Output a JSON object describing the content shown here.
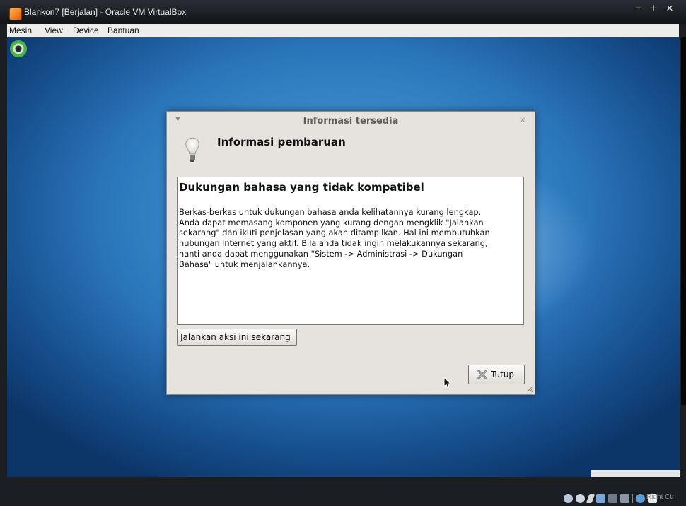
{
  "window": {
    "title": "Blankon7 [Berjalan] - Oracle VM VirtualBox",
    "controls": [
      "−",
      "+",
      "×"
    ]
  },
  "menubar": {
    "items": [
      "Mesin",
      "View",
      "Device",
      "Bantuan"
    ]
  },
  "dialog": {
    "title": "Informasi tersedia",
    "heading": "Informasi pembaruan",
    "info_title": "Dukungan bahasa yang tidak kompatibel",
    "info_lines": [
      "Berkas-berkas untuk dukungan bahasa anda kelihatannya kurang lengkap.",
      "Anda dapat memasang komponen yang kurang dengan mengklik \"Jalankan",
      "sekarang\" dan ikuti penjelasan yang akan ditampilkan. Hal ini membutuhkan",
      "hubungan internet yang aktif. Bila anda tidak ingin melakukannya sekarang,",
      "nanti anda dapat menggunakan \"Sistem -> Administrasi -> Dukungan",
      "Bahasa\" untuk menjalankannya."
    ],
    "action_button": "Jalankan aksi ini sekarang",
    "close_button": "Tutup"
  },
  "statusbar": {
    "host_key": "Right Ctrl",
    "icons": [
      "hard-disk-icon",
      "cd-icon",
      "usb-icon",
      "network-icon",
      "shared-folder-icon",
      "display-icon",
      "mouse-integration-icon",
      "host-key-icon"
    ]
  },
  "colors": {
    "desktop": "#2b76bb",
    "dialog_bg": "#e6e3de",
    "titlebar": "#1b1e22"
  }
}
